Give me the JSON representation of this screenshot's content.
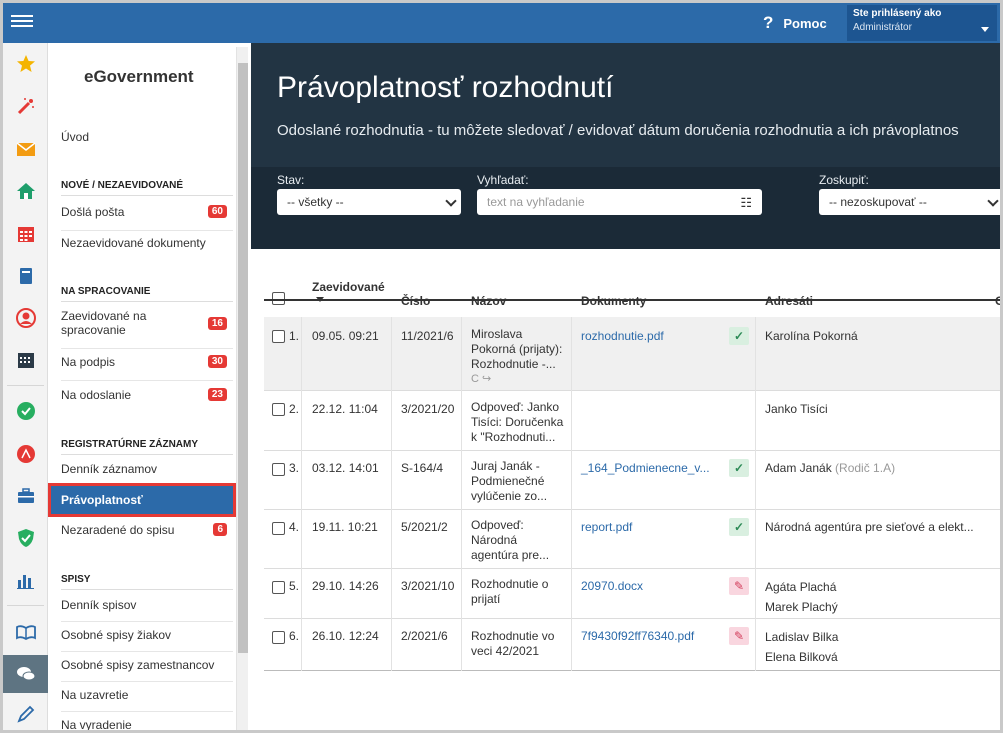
{
  "topbar": {
    "help_label": "Pomoc",
    "user_title": "Ste prihlásený ako",
    "user_name": "Administrátor"
  },
  "sidebar": {
    "brand": "eGovernment",
    "home": "Úvod",
    "sections": [
      {
        "title": "NOVÉ / NEZAEVIDOVANÉ",
        "items": [
          {
            "label": "Došlá pošta",
            "badge": "60"
          },
          {
            "label": "Nezaevidované dokumenty",
            "badge": ""
          }
        ]
      },
      {
        "title": "NA SPRACOVANIE",
        "items": [
          {
            "label": "Zaevidované na spracovanie",
            "badge": "16"
          },
          {
            "label": "Na podpis",
            "badge": "30"
          },
          {
            "label": "Na odoslanie",
            "badge": "23"
          }
        ]
      },
      {
        "title": "REGISTRATÚRNE ZÁZNAMY",
        "items": [
          {
            "label": "Denník záznamov",
            "badge": ""
          },
          {
            "label": "Právoplatnosť",
            "badge": ""
          },
          {
            "label": "Nezaradené do spisu",
            "badge": "6"
          }
        ]
      },
      {
        "title": "SPISY",
        "items": [
          {
            "label": "Denník spisov",
            "badge": ""
          },
          {
            "label": "Osobné spisy žiakov",
            "badge": ""
          },
          {
            "label": "Osobné spisy zamestnancov",
            "badge": ""
          },
          {
            "label": "Na uzavretie",
            "badge": ""
          },
          {
            "label": "Na vyradenie",
            "badge": ""
          }
        ]
      }
    ]
  },
  "page": {
    "title": "Právoplatnosť rozhodnutí",
    "subtitle": "Odoslané rozhodnutia - tu môžete sledovať / evidovať dátum doručenia rozhodnutia a ich právoplatnos"
  },
  "filters": {
    "status_label": "Stav:",
    "status_value": "-- všetky --",
    "search_label": "Vyhľadať:",
    "search_placeholder": "text na vyhľadanie",
    "group_label": "Zoskupiť:",
    "group_value": "-- nezoskupovať --"
  },
  "table": {
    "headers": {
      "registered": "Zaevidované",
      "number": "Číslo",
      "name": "Názov",
      "documents": "Dokumenty",
      "recipients": "Adresáti",
      "extra": "C"
    },
    "rows": [
      {
        "idx": "1.",
        "date": "09.05. 09:21",
        "number": "11/2021/6",
        "name": [
          "Miroslava",
          "Pokorná (prijaty):",
          "Rozhodnutie -..."
        ],
        "name_extra": "C",
        "doc": "rozhodnutie.pdf",
        "doc_state": "ok",
        "recipients": [
          "Karolína Pokorná"
        ],
        "recipient_note": ""
      },
      {
        "idx": "2.",
        "date": "22.12. 11:04",
        "number": "3/2021/20",
        "name": [
          "Odpoveď: Janko",
          "Tisíci: Doručenka",
          "k \"Rozhodnuti..."
        ],
        "name_extra": "",
        "doc": "",
        "doc_state": "",
        "recipients": [
          "Janko Tisíci"
        ],
        "recipient_note": ""
      },
      {
        "idx": "3.",
        "date": "03.12. 14:01",
        "number": "S-164/4",
        "name": [
          "Juraj Janák -",
          "Podmienečné",
          "vylúčenie zo..."
        ],
        "name_extra": "",
        "doc": "_164_Podmienecne_v...",
        "doc_state": "ok",
        "recipients": [
          "Adam Janák"
        ],
        "recipient_note": "(Rodič 1.A)"
      },
      {
        "idx": "4.",
        "date": "19.11. 10:21",
        "number": "5/2021/2",
        "name": [
          "Odpoveď:",
          "Národná",
          "agentúra pre..."
        ],
        "name_extra": "",
        "doc": "report.pdf",
        "doc_state": "ok",
        "recipients": [
          "Národná agentúra pre sieťové a elekt..."
        ],
        "recipient_note": ""
      },
      {
        "idx": "5.",
        "date": "29.10. 14:26",
        "number": "3/2021/10",
        "name": [
          "Rozhodnutie o",
          "prijatí"
        ],
        "name_extra": "",
        "doc": "20970.docx",
        "doc_state": "edit",
        "recipients": [
          "Agáta Plachá",
          "Marek Plachý"
        ],
        "recipient_note": ""
      },
      {
        "idx": "6.",
        "date": "26.10. 12:24",
        "number": "2/2021/6",
        "name": [
          "Rozhodnutie vo",
          "veci 42/2021"
        ],
        "name_extra": "",
        "doc": "7f9430f92ff76340.pdf",
        "doc_state": "edit",
        "recipients": [
          "Ladislav Bilka",
          "Elena Bilková"
        ],
        "recipient_note": ""
      }
    ]
  },
  "colors": {
    "topbar": "#2c6aa9",
    "hero": "#223443",
    "badge": "#e53935",
    "link": "#2c6aa9"
  },
  "icons": [
    "menu-icon",
    "help-icon",
    "star-icon",
    "magic-wand-icon",
    "mail-icon",
    "home-icon",
    "calendar-icon",
    "book-icon",
    "user-icon",
    "calendar-grid-icon",
    "check-circle-icon",
    "stamp-icon",
    "briefcase-icon",
    "shield-check-icon",
    "chart-icon",
    "open-book-icon",
    "chat-icon",
    "pen-icon"
  ]
}
